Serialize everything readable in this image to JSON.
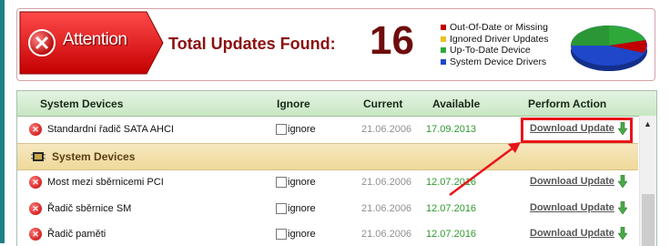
{
  "summary": {
    "attention_label": "Attention",
    "total_label": "Total Updates Found:",
    "total_count": "16",
    "legend": [
      {
        "label": "Out-Of-Date or Missing",
        "color": "#c00000"
      },
      {
        "label": "Ignored Driver Updates",
        "color": "#f0c020"
      },
      {
        "label": "Up-To-Date Device",
        "color": "#2fa83a"
      },
      {
        "label": "System Device Drivers",
        "color": "#1f47c9"
      }
    ]
  },
  "table": {
    "headers": {
      "device": "System Devices",
      "ignore": "Ignore",
      "current": "Current",
      "available": "Available",
      "action": "Perform Action"
    },
    "group_label": "System Devices",
    "rows": [
      {
        "name": "Standardní řadič  SATA AHCI",
        "ignore_label": "ignore",
        "current": "21.06.2006",
        "available": "17.09.2013",
        "action": "Download Update"
      },
      {
        "name": "Most mezi sběrnicemi PCI",
        "ignore_label": "ignore",
        "current": "21.06.2006",
        "available": "12.07.2016",
        "action": "Download Update"
      },
      {
        "name": "Řadič sběrnice SM",
        "ignore_label": "ignore",
        "current": "21.06.2006",
        "available": "12.07.2016",
        "action": "Download Update"
      },
      {
        "name": "Řadič paměti",
        "ignore_label": "ignore",
        "current": "21.06.2006",
        "available": "12.07.2016",
        "action": "Download Update"
      }
    ]
  }
}
